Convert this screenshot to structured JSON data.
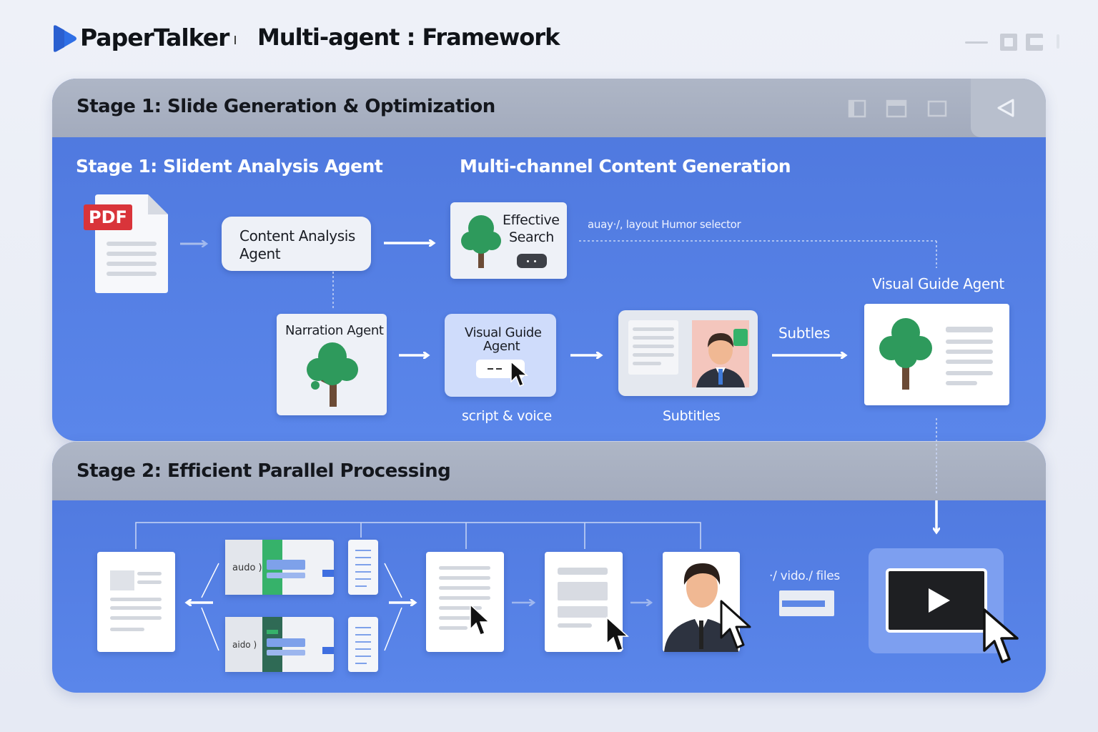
{
  "header": {
    "app_name": "PaperTalker",
    "separator": "ı",
    "title": "Multi-agent : Framework"
  },
  "stage1": {
    "header_title": "Stage 1: Slide Generation & Optimization",
    "left_subtitle": "Stage 1:  Slident Analysis Agent",
    "right_subtitle": "Multi-channel Content Generation",
    "pdf_badge": "PDF",
    "content_analysis_line1": "Content Analysis",
    "content_analysis_line2": "Agent",
    "effective_search_line1": "Effective",
    "effective_search_line2": "Search",
    "dotted_label": "auay·/, layout Humor selector",
    "visual_guide_agent_top": "Visual Guide Agent",
    "narration_agent": "Narration Agent",
    "visual_guide_line1": "Visual Guide",
    "visual_guide_line2": "Agent",
    "script_voice": "script & voice",
    "subtitles_arrow_label": "Subtles",
    "subtitles_bottom_label": "Subtitles"
  },
  "stage2": {
    "header_title": "Stage 2: Efficient Parallel Processing",
    "audio_label_1": "audo )",
    "audio_label_2": "aido )",
    "video_files_label": "·/ vido./ files"
  },
  "colors": {
    "panel_blue": "#5a86ea",
    "panel_header_gray": "#a9b1c2",
    "logo_blue": "#2f6fe6",
    "pdf_red": "#d9343a",
    "tree_green": "#2e9a5c",
    "accent_green": "#36b26a"
  },
  "icons": [
    "play-logo-icon",
    "minimize-icon",
    "restore-icon",
    "close-icon",
    "pdf-file-icon",
    "tree-icon",
    "presenter-icon",
    "cursor-icon",
    "video-play-icon",
    "back-icon"
  ]
}
